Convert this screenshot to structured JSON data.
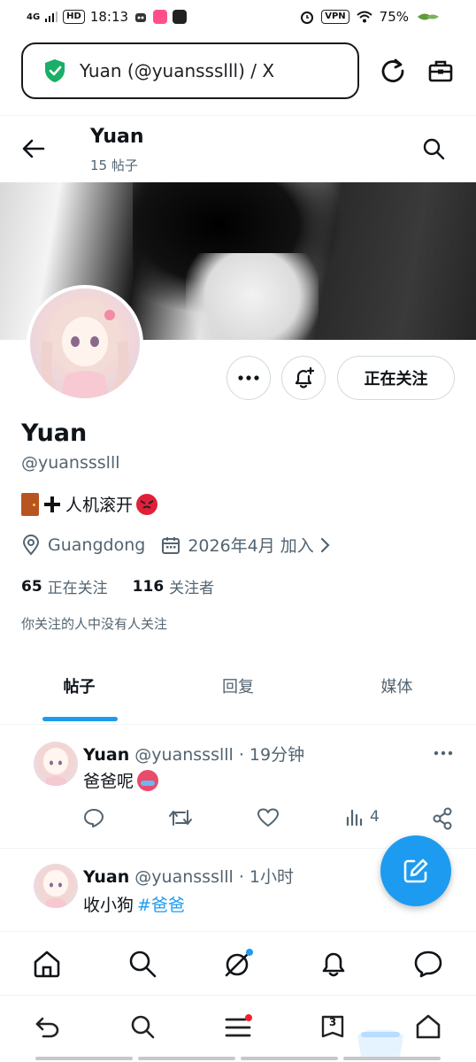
{
  "status_bar": {
    "network": "4G",
    "hd": "HD",
    "time": "18:13",
    "vpn": "VPN",
    "battery": "75%"
  },
  "browser": {
    "url_text": "Yuan (@yuanssslll) / X"
  },
  "header": {
    "title": "Yuan",
    "subtitle": "15 帖子"
  },
  "profile": {
    "following_button": "正在关注",
    "name": "Yuan",
    "handle": "@yuanssslll",
    "bio_text": "人机滚开",
    "location": "Guangdong",
    "joined": "2026年4月 加入",
    "following_count": "65",
    "following_label": "正在关注",
    "followers_count": "116",
    "followers_label": "关注者",
    "mutual_note": "你关注的人中没有人关注"
  },
  "tabs": [
    "帖子",
    "回复",
    "媒体"
  ],
  "tweets": [
    {
      "name": "Yuan",
      "handle": "@yuanssslll",
      "time": " · 19分钟",
      "text": "爸爸呢",
      "views": "4"
    },
    {
      "name": "Yuan",
      "handle": "@yuanssslll",
      "time": " · 1小时",
      "text": "收小狗",
      "hashtag": "#爸爸"
    }
  ],
  "browser_bar": {
    "tab_count": "3"
  },
  "colors": {
    "accent": "#1d9bf0",
    "secondary_text": "#536471",
    "notification_dot": "#f4212e",
    "shield_green": "#1aae67"
  }
}
